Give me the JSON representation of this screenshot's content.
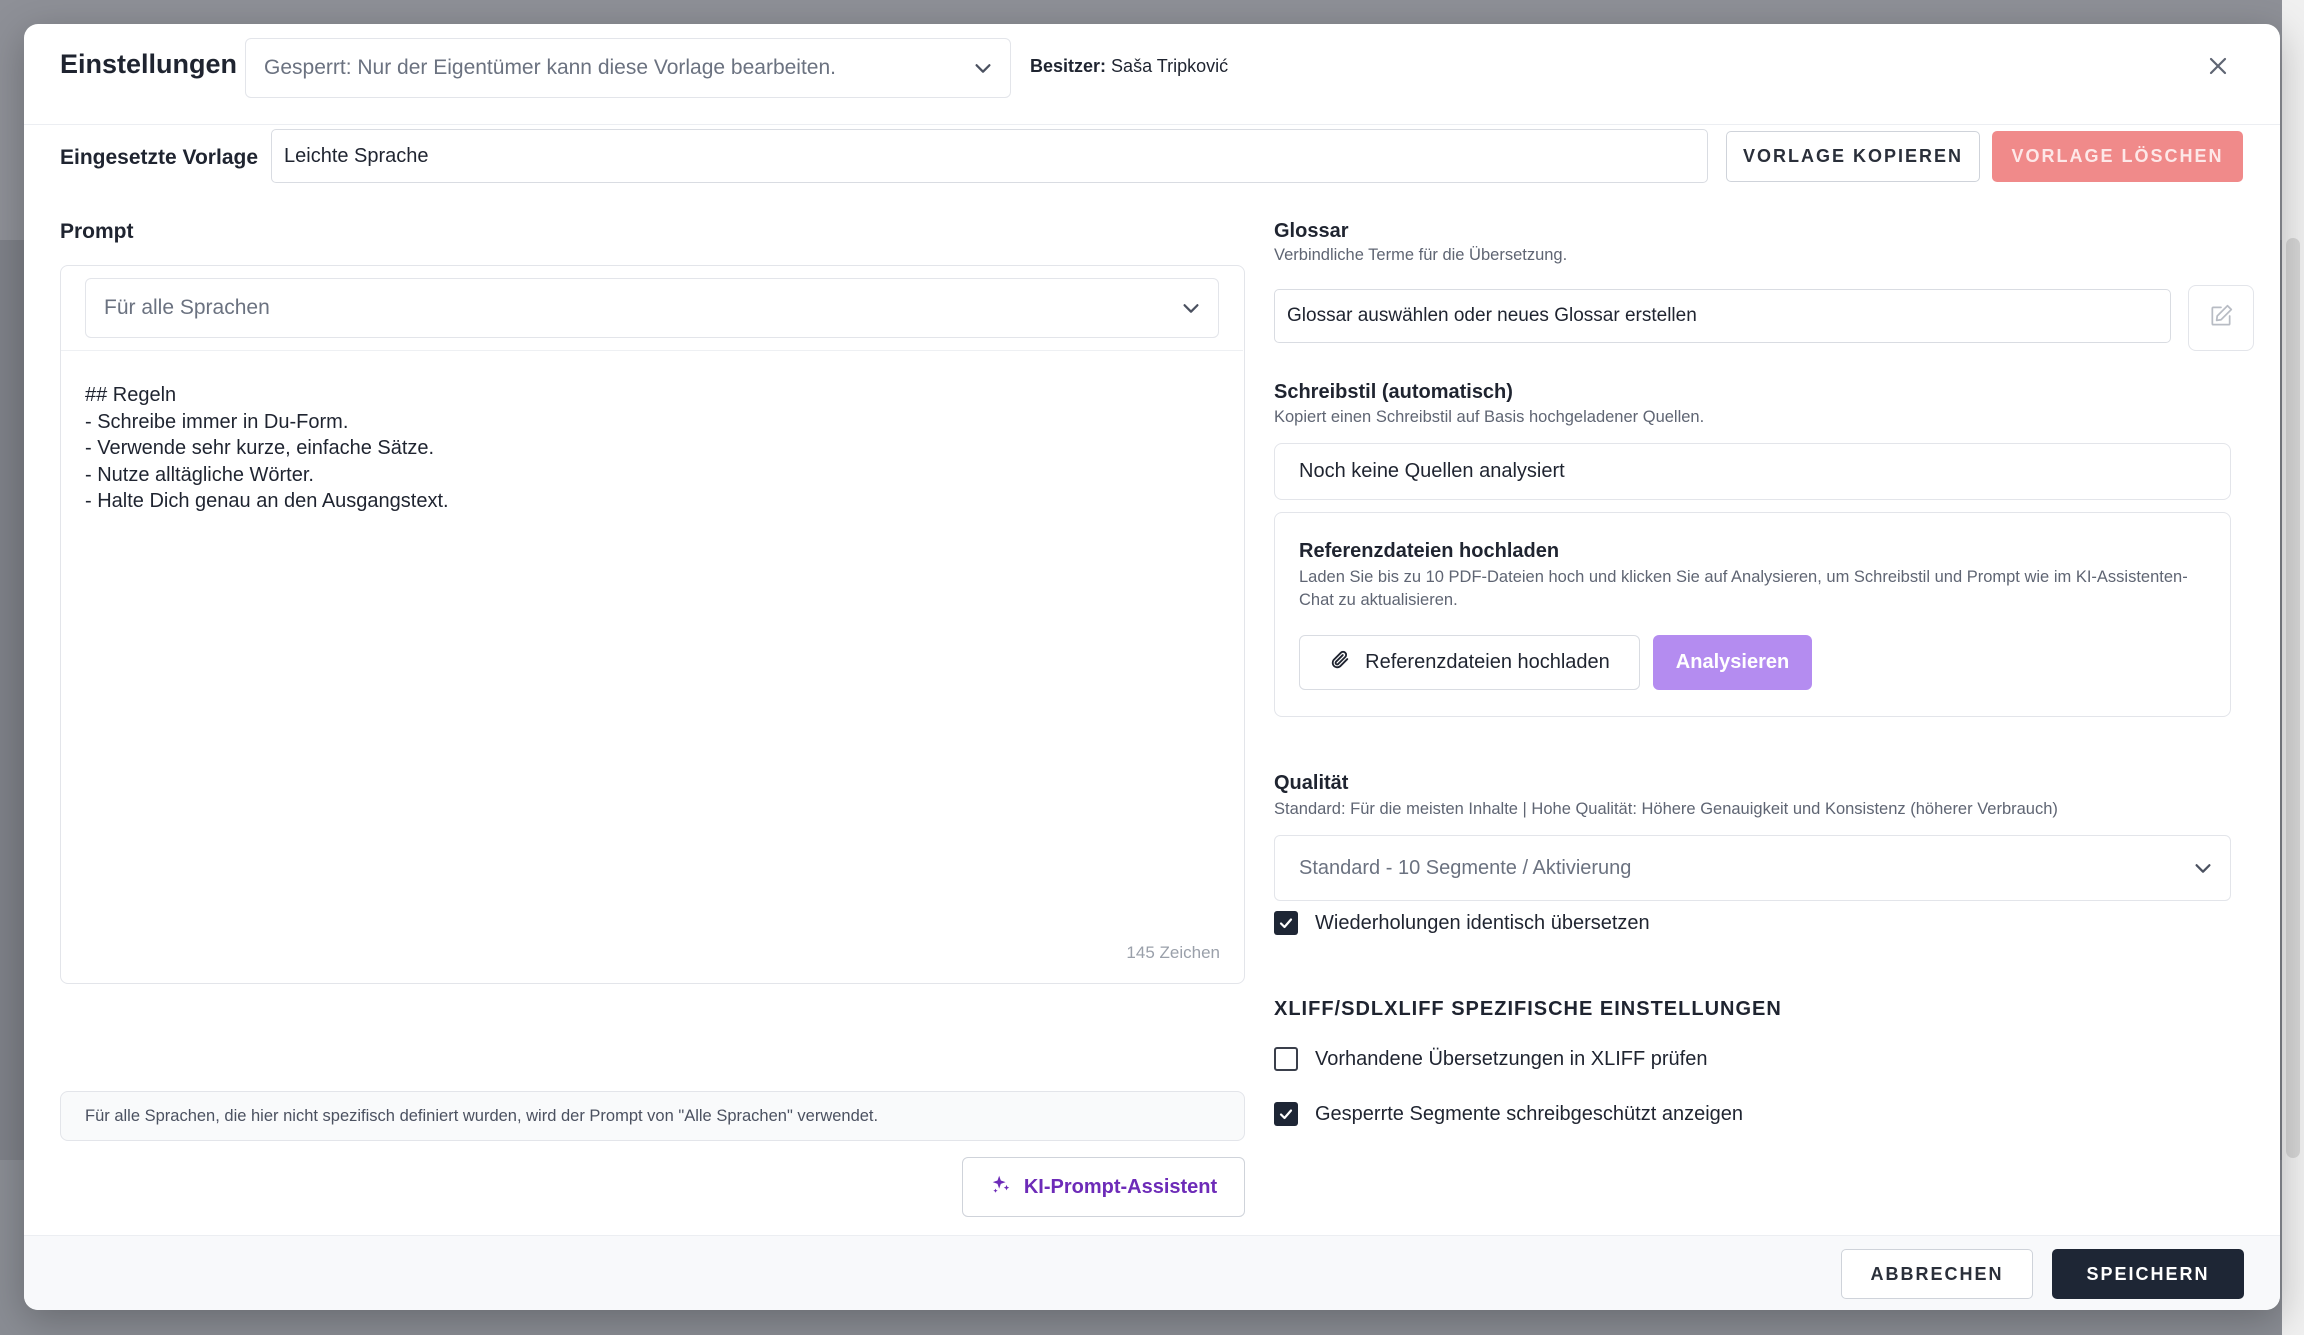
{
  "header": {
    "title": "Einstellungen",
    "lock_select_value": "Gesperrt: Nur der Eigentümer kann diese Vorlage bearbeiten.",
    "owner_label": "Besitzer:",
    "owner_name": "Saša Tripković"
  },
  "template": {
    "label": "Eingesetzte Vorlage",
    "value": "Leichte Sprache",
    "copy_button": "VORLAGE KOPIEREN",
    "delete_button": "VORLAGE LÖSCHEN"
  },
  "prompt": {
    "label": "Prompt",
    "language_select": "Für alle Sprachen",
    "lines": [
      "## Regeln",
      "- Schreibe immer in Du-Form.",
      "- Verwende sehr kurze, einfache Sätze.",
      "- Nutze alltägliche Wörter.",
      "- Halte Dich genau an den Ausgangstext."
    ],
    "char_count": "145 Zeichen",
    "hint": "Für alle Sprachen, die hier nicht spezifisch definiert wurden, wird der Prompt von \"Alle Sprachen\" verwendet.",
    "assistant_button": "KI-Prompt-Assistent"
  },
  "glossar": {
    "title": "Glossar",
    "subtitle": "Verbindliche Terme für die Übersetzung.",
    "input_value": "Glossar auswählen oder neues Glossar erstellen"
  },
  "style": {
    "title": "Schreibstil (automatisch)",
    "subtitle": "Kopiert einen Schreibstil auf Basis hochgeladener Quellen.",
    "status": "Noch keine Quellen analysiert",
    "ref_title": "Referenzdateien hochladen",
    "ref_desc": "Laden Sie bis zu 10 PDF-Dateien hoch und klicken Sie auf Analysieren, um Schreibstil und Prompt wie im KI-Assistenten-Chat zu aktualisieren.",
    "upload_button": "Referenzdateien hochladen",
    "analyze_button": "Analysieren"
  },
  "quality": {
    "title": "Qualität",
    "subtitle": "Standard: Für die meisten Inhalte | Hohe Qualität: Höhere Genauigkeit und Konsistenz (höherer Verbrauch)",
    "select_value": "Standard - 10 Segmente / Aktivierung"
  },
  "options": {
    "repeat_identical": {
      "label": "Wiederholungen identisch übersetzen",
      "checked": true
    },
    "xliff_title": "XLIFF/SDLXLIFF SPEZIFISCHE EINSTELLUNGEN",
    "check_existing": {
      "label": "Vorhandene Übersetzungen in XLIFF prüfen",
      "checked": false
    },
    "locked_readonly": {
      "label": "Gesperrte Segmente schreibgeschützt anzeigen",
      "checked": true
    }
  },
  "footer": {
    "cancel_button": "ABBRECHEN",
    "save_button": "SPEICHERN"
  },
  "colors": {
    "primary_dark": "#1e2635",
    "danger": "#f08a8a",
    "accent_purple": "#b48cf0",
    "assistant_purple": "#6d2bb8"
  }
}
